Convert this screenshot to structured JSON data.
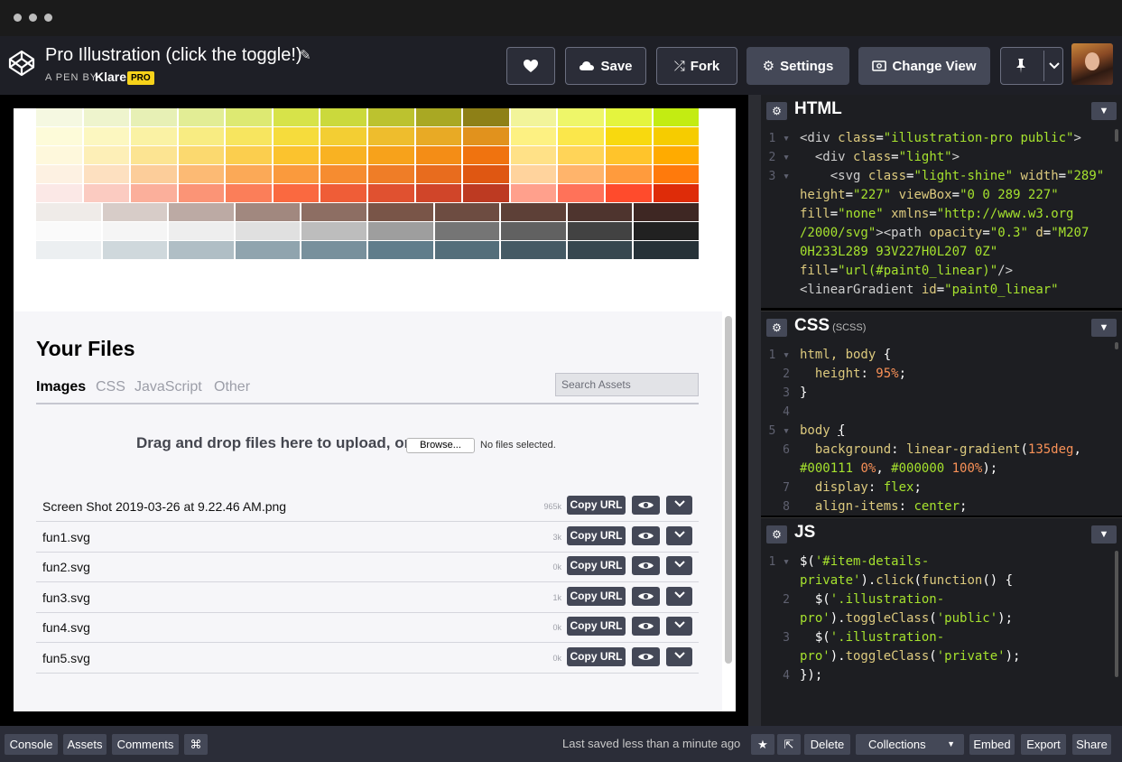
{
  "pen": {
    "title": "Pro Illustration (click the toggle!)",
    "by_label": "A PEN BY",
    "author": "Klare",
    "badge": "PRO"
  },
  "header_buttons": {
    "save": "Save",
    "fork": "Fork",
    "settings": "Settings",
    "change_view": "Change View"
  },
  "swatch_rows": [
    [
      "#f5f8e1",
      "#eef4cd",
      "#e7f0b5",
      "#e2ed95",
      "#dde972",
      "#d7e349",
      "#cbd93c",
      "#bcc22f",
      "#a9a823",
      "#8e8017",
      "#f2f49a",
      "#eef669",
      "#e4f43e",
      "#c3ec12"
    ],
    [
      "#fdfbd9",
      "#fcf7c0",
      "#faf2a4",
      "#f8ec82",
      "#f7e55f",
      "#f6dc3c",
      "#f3ce33",
      "#eebd2d",
      "#e8aa25",
      "#e1921d",
      "#fdf182",
      "#fbe74b",
      "#f8d90f",
      "#f6cc00"
    ],
    [
      "#fef8dc",
      "#fdefb7",
      "#fce492",
      "#fbd96f",
      "#fbce4e",
      "#fbc32e",
      "#f9b222",
      "#f7a21b",
      "#f48d16",
      "#f0730f",
      "#ffe187",
      "#ffd458",
      "#ffc42b",
      "#ffab00"
    ],
    [
      "#fdf1e2",
      "#fde0c0",
      "#fccd9a",
      "#fcba74",
      "#fba957",
      "#fa9a3d",
      "#f68c30",
      "#ef7d27",
      "#e86c1e",
      "#df5712",
      "#ffd39d",
      "#ffb46b",
      "#ff9b3d",
      "#ff7a0c"
    ],
    [
      "#fbe8e6",
      "#fbcbc1",
      "#fbaf9b",
      "#fb9476",
      "#fb7e59",
      "#fa6940",
      "#ef5d37",
      "#e05130",
      "#d04529",
      "#bd3a22",
      "#ffa08c",
      "#ff7259",
      "#ff4b2c",
      "#de2c09"
    ],
    [
      "#efebe8",
      "#d7ccc8",
      "#bcaaa4",
      "#a1887f",
      "#8d6e63",
      "#795548",
      "#6d4c41",
      "#5d4037",
      "#4e342e",
      "#3e2723"
    ],
    [
      "#fafafa",
      "#f5f5f5",
      "#eeeeee",
      "#e0e0e0",
      "#bdbdbd",
      "#9e9e9e",
      "#757575",
      "#616161",
      "#424242",
      "#212121"
    ],
    [
      "#eceff1",
      "#cfd8dc",
      "#b0bec5",
      "#90a4ae",
      "#78909c",
      "#607d8b",
      "#546e7a",
      "#455a64",
      "#37474f",
      "#263238"
    ]
  ],
  "assets": {
    "title": "Your Files",
    "tabs": [
      "Images",
      "CSS",
      "JavaScript",
      "Other"
    ],
    "search_placeholder": "Search Assets",
    "drop_text": "Drag and drop files here to upload, or",
    "browse_label": "Browse...",
    "no_files": "No files selected.",
    "copy_label": "Copy URL",
    "files": [
      {
        "name": "Screen Shot 2019-03-26 at 9.22.46 AM.png",
        "size": "965k"
      },
      {
        "name": "fun1.svg",
        "size": "3k"
      },
      {
        "name": "fun2.svg",
        "size": "0k"
      },
      {
        "name": "fun3.svg",
        "size": "1k"
      },
      {
        "name": "fun4.svg",
        "size": "0k"
      },
      {
        "name": "fun5.svg",
        "size": "0k"
      }
    ]
  },
  "editors": {
    "html_title": "HTML",
    "css_title": "CSS",
    "css_sub": "(SCSS)",
    "js_title": "JS"
  },
  "footer": {
    "console": "Console",
    "assets": "Assets",
    "comments": "Comments",
    "cmd": "⌘",
    "saved": "Last saved less than a minute ago",
    "delete": "Delete",
    "collections": "Collections",
    "embed": "Embed",
    "export": "Export",
    "share": "Share"
  }
}
